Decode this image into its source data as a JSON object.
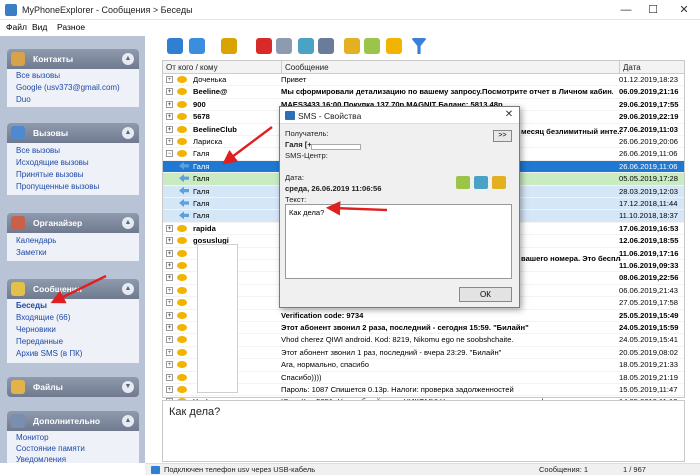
{
  "window": {
    "title": "MyPhoneExplorer - Сообщения > Беседы",
    "minimize": "—",
    "maximize": "☐",
    "close": "✕"
  },
  "menu": [
    "Файл",
    "Вид",
    "Разное"
  ],
  "sidebar": [
    {
      "title": "Контакты",
      "items": [
        "Все вызовы",
        "Google (usv373@gmail.com)",
        "Duo"
      ]
    },
    {
      "title": "Вызовы",
      "items": [
        "Все вызовы",
        "Исходящие вызовы",
        "Принятые вызовы",
        "Пропущенные вызовы"
      ]
    },
    {
      "title": "Органайзер",
      "items": [
        "Календарь",
        "Заметки"
      ]
    },
    {
      "title": "Сообщения",
      "items": [
        "Беседы",
        "Входящие (66)",
        "Черновики",
        "Переданные",
        "Архив SMS (в ПК)"
      ]
    },
    {
      "title": "Файлы",
      "items": []
    },
    {
      "title": "Дополнительно",
      "items": [
        "Монитор",
        "Состояние памяти",
        "Уведомления"
      ]
    }
  ],
  "list": {
    "headers": [
      "От кого / кому",
      "Сообщение",
      "Дата"
    ],
    "rows": [
      {
        "name": "Доченька",
        "msg": "Привет",
        "date": "01.12.2019,",
        "time": "18:23",
        "bold": false
      },
      {
        "name": "Beeline@",
        "msg": "Мы сформировали детализацию по вашему запросу.Посмотрите отчет в Личном кабин...",
        "date": "06.09.2019,",
        "time": "21:16",
        "bold": true
      },
      {
        "name": "900",
        "msg": "МАЕS3433 16:00 Покупка 137.70р MAGNIT Баланс: 5813.48р",
        "date": "29.06.2019,",
        "time": "17:55",
        "bold": true
      },
      {
        "name": "5678",
        "msg": "",
        "date": "29.06.2019,",
        "time": "22:19",
        "bold": true
      },
      {
        "name": "BeelineClub",
        "msg": "",
        "date": "27.06.2019,",
        "time": "11:03",
        "bold": true
      },
      {
        "name": "Лариска",
        "msg": "",
        "date": "26.06.2019,",
        "time": "20:06",
        "bold": false
      },
      {
        "name": "Галя",
        "msg": "",
        "date": "26.06.2019,",
        "time": "11:06",
        "bold": false
      }
    ],
    "sub_rows": [
      {
        "name": "Галя",
        "date": "26.06.2019,",
        "time": "11:06"
      },
      {
        "name": "Галя",
        "date": "05.05.2019,",
        "time": "17:28"
      },
      {
        "name": "Галя",
        "date": "28.03.2019,",
        "time": "12:03"
      },
      {
        "name": "Галя",
        "date": "17.12.2018,",
        "time": "11:44"
      },
      {
        "name": "Галя",
        "date": "11.10.2018,",
        "time": "18:37"
      }
    ],
    "rows2": [
      {
        "name": "rapida",
        "msg": "",
        "date": "17.06.2019,",
        "time": "16:53",
        "bold": true
      },
      {
        "name": "gosuslugi",
        "msg": "",
        "date": "12.06.2019,",
        "time": "18:55",
        "bold": true
      },
      {
        "name": "",
        "msg": "",
        "date": "11.06.2019,",
        "time": "17:16",
        "bold": true
      },
      {
        "name": "",
        "msg": "",
        "date": "11.06.2019,",
        "time": "09:33",
        "bold": true
      },
      {
        "name": "",
        "msg": "",
        "date": "08.06.2019,",
        "time": "22:56",
        "bold": true
      },
      {
        "name": "",
        "msg": "",
        "date": "06.06.2019,",
        "time": "21:43",
        "bold": false
      },
      {
        "name": "",
        "msg": "",
        "date": "27.05.2019,",
        "time": "17:58",
        "bold": false
      },
      {
        "name": "",
        "msg": "Verification code: 9734",
        "date": "25.05.2019,",
        "time": "15:49",
        "bold": true
      },
      {
        "name": "",
        "msg": "Этот абонент звонил 2 раза, последний - сегодня 15:59. \"Билайн\"",
        "date": "24.05.2019,",
        "time": "15:59",
        "bold": true
      },
      {
        "name": "",
        "msg": "Vhod cherez QIWI android. Kod: 8219, Nikomu ego ne soobshchaite.",
        "date": "24.05.2019,",
        "time": "15:41",
        "bold": false
      },
      {
        "name": "",
        "msg": "Этот абонент звонил 1 раз, последний - вчера 23:29. \"Билайн\"",
        "date": "20.05.2019,",
        "time": "08:02",
        "bold": false
      },
      {
        "name": "",
        "msg": "Ага, нормально, спасибо",
        "date": "18.05.2019,",
        "time": "21:33",
        "bold": false
      },
      {
        "name": "",
        "msg": "Спасибо))))",
        "date": "18.05.2019,",
        "time": "21:19",
        "bold": false
      },
      {
        "name": "",
        "msg": "Пароль: 1087 Спишется 0.13р. Налоги: проверка задолженностей",
        "date": "15.05.2019,",
        "time": "11:47",
        "bold": false
      },
      {
        "name": "YouLa",
        "msg": "Юла: Код 5051. Не сообщайте его НИКОМУ! Установите приложение: youla.ru",
        "date": "14.05.2019,",
        "time": "11:10",
        "bold": false
      }
    ]
  },
  "dialog": {
    "title": "SMS - Свойства",
    "recipients_label": "Получатель:",
    "recipient": "Галя [+",
    "center_label": "SMS-Центр:",
    "date_label": "Дата:",
    "date_value": "среда, 26.06.2019 11:06:56",
    "text_label": "Текст:",
    "text_value": "Как дела?",
    "forward_btn": ">>",
    "ok_btn": "ОК",
    "bg_text1": "месяц безлимитный инте...",
    "bg_text2": "вашего номера. Это бесплатно..."
  },
  "preview": {
    "text": "Как дела?"
  },
  "status": {
    "text": "Подключен телефон usv через USB-кабель",
    "group": "Сообщения: 1",
    "count": "1 / 967"
  },
  "colors": {
    "selection": "#1f78d1",
    "sidebar": "#b8c3d6",
    "arrow": "#e02020"
  }
}
